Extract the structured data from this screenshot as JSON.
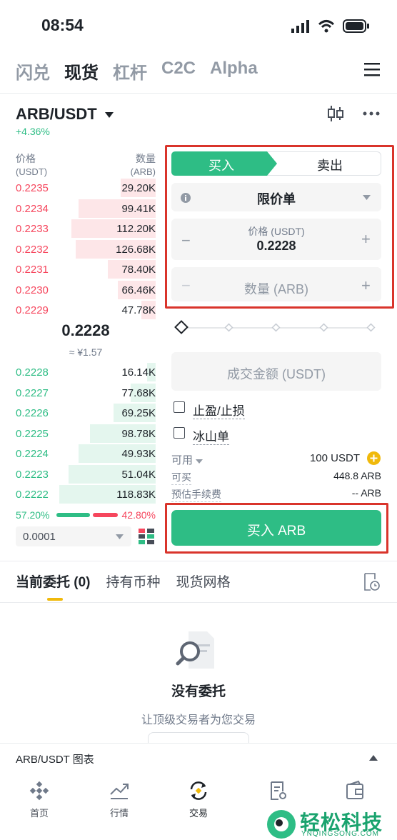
{
  "status": {
    "time": "08:54"
  },
  "top_nav": [
    "闪兑",
    "现货",
    "杠杆",
    "C2C",
    "Alpha"
  ],
  "pair": {
    "name": "ARB/USDT",
    "change": "+4.36%"
  },
  "orderbook": {
    "price_head": "价格",
    "price_unit": "(USDT)",
    "qty_head": "数量",
    "qty_unit": "(ARB)",
    "asks": [
      {
        "price": "0.2235",
        "qty": "29.20K",
        "depth": 0.25
      },
      {
        "price": "0.2234",
        "qty": "99.41K",
        "depth": 0.55
      },
      {
        "price": "0.2233",
        "qty": "112.20K",
        "depth": 0.6
      },
      {
        "price": "0.2232",
        "qty": "126.68K",
        "depth": 0.57
      },
      {
        "price": "0.2231",
        "qty": "78.40K",
        "depth": 0.34
      },
      {
        "price": "0.2230",
        "qty": "66.46K",
        "depth": 0.27
      },
      {
        "price": "0.2229",
        "qty": "47.78K",
        "depth": 0.1
      }
    ],
    "last_price": "0.2228",
    "last_fiat": "≈ ¥1.57",
    "bids": [
      {
        "price": "0.2228",
        "qty": "16.14K",
        "depth": 0.06
      },
      {
        "price": "0.2227",
        "qty": "77.68K",
        "depth": 0.18
      },
      {
        "price": "0.2226",
        "qty": "69.25K",
        "depth": 0.3
      },
      {
        "price": "0.2225",
        "qty": "98.78K",
        "depth": 0.47
      },
      {
        "price": "0.2224",
        "qty": "49.93K",
        "depth": 0.55
      },
      {
        "price": "0.2223",
        "qty": "51.04K",
        "depth": 0.62
      },
      {
        "price": "0.2222",
        "qty": "118.83K",
        "depth": 0.69
      }
    ],
    "buy_ratio": "57.20%",
    "sell_ratio": "42.80%",
    "buy_ratio_value": 0.572,
    "precision": "0.0001"
  },
  "order_form": {
    "buy_tab": "买入",
    "sell_tab": "卖出",
    "order_type": "限价单",
    "price_label": "价格 (USDT)",
    "price_value": "0.2228",
    "qty_placeholder": "数量 (ARB)",
    "total_placeholder": "成交金额 (USDT)",
    "tp_sl": "止盈/止损",
    "iceberg": "冰山单",
    "available_label": "可用",
    "available_value": "100 USDT",
    "can_buy_label": "可买",
    "can_buy_value": "448.8 ARB",
    "fee_label": "预估手续费",
    "fee_value": "-- ARB",
    "submit": "买入 ARB"
  },
  "tabs": {
    "open_orders": "当前委托 (0)",
    "holdings": "持有币种",
    "grid": "现货网格"
  },
  "empty": {
    "title": "没有委托",
    "subtitle": "让顶级交易者为您交易"
  },
  "chart_bar": {
    "label": "ARB/USDT 图表"
  },
  "bottom_nav": [
    "首页",
    "行情",
    "交易",
    "",
    ""
  ],
  "watermark": {
    "cn": "轻松科技",
    "en": "YNQINGSONG.COM"
  },
  "colors": {
    "green": "#2ebd85",
    "red": "#f6465d",
    "accent": "#2ebd85",
    "highlight": "#d9342b",
    "yellow": "#f0b90b"
  }
}
